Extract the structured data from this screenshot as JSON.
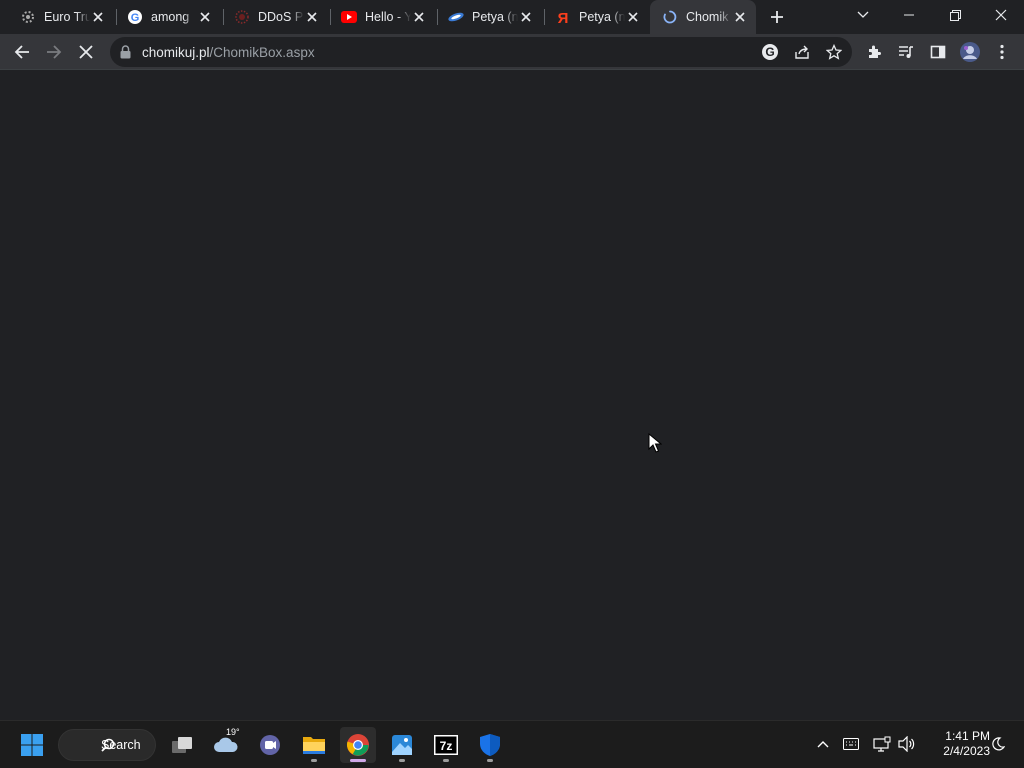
{
  "tabs": [
    {
      "title": "Euro Tru",
      "icon": "ets-icon"
    },
    {
      "title": "among",
      "icon": "google-icon"
    },
    {
      "title": "DDoS P",
      "icon": "ddos-icon"
    },
    {
      "title": "Hello - Y",
      "icon": "youtube-icon"
    },
    {
      "title": "Petya (n",
      "icon": "petya-icon"
    },
    {
      "title": "Petya (n",
      "icon": "yandex-icon"
    },
    {
      "title": "Chomik",
      "icon": "loading-spinner-icon",
      "active": true
    }
  ],
  "address_bar": {
    "host": "chomikuj.pl",
    "path": "/ChomikBox.aspx"
  },
  "taskbar": {
    "search_label": "Search",
    "weather_temp": "19°",
    "time": "1:41 PM",
    "date": "2/4/2023"
  },
  "colors": {
    "background": "#202124",
    "toolbar": "#35363a",
    "taskbar": "#1c1c1c",
    "accent": "#8ab4f8"
  }
}
